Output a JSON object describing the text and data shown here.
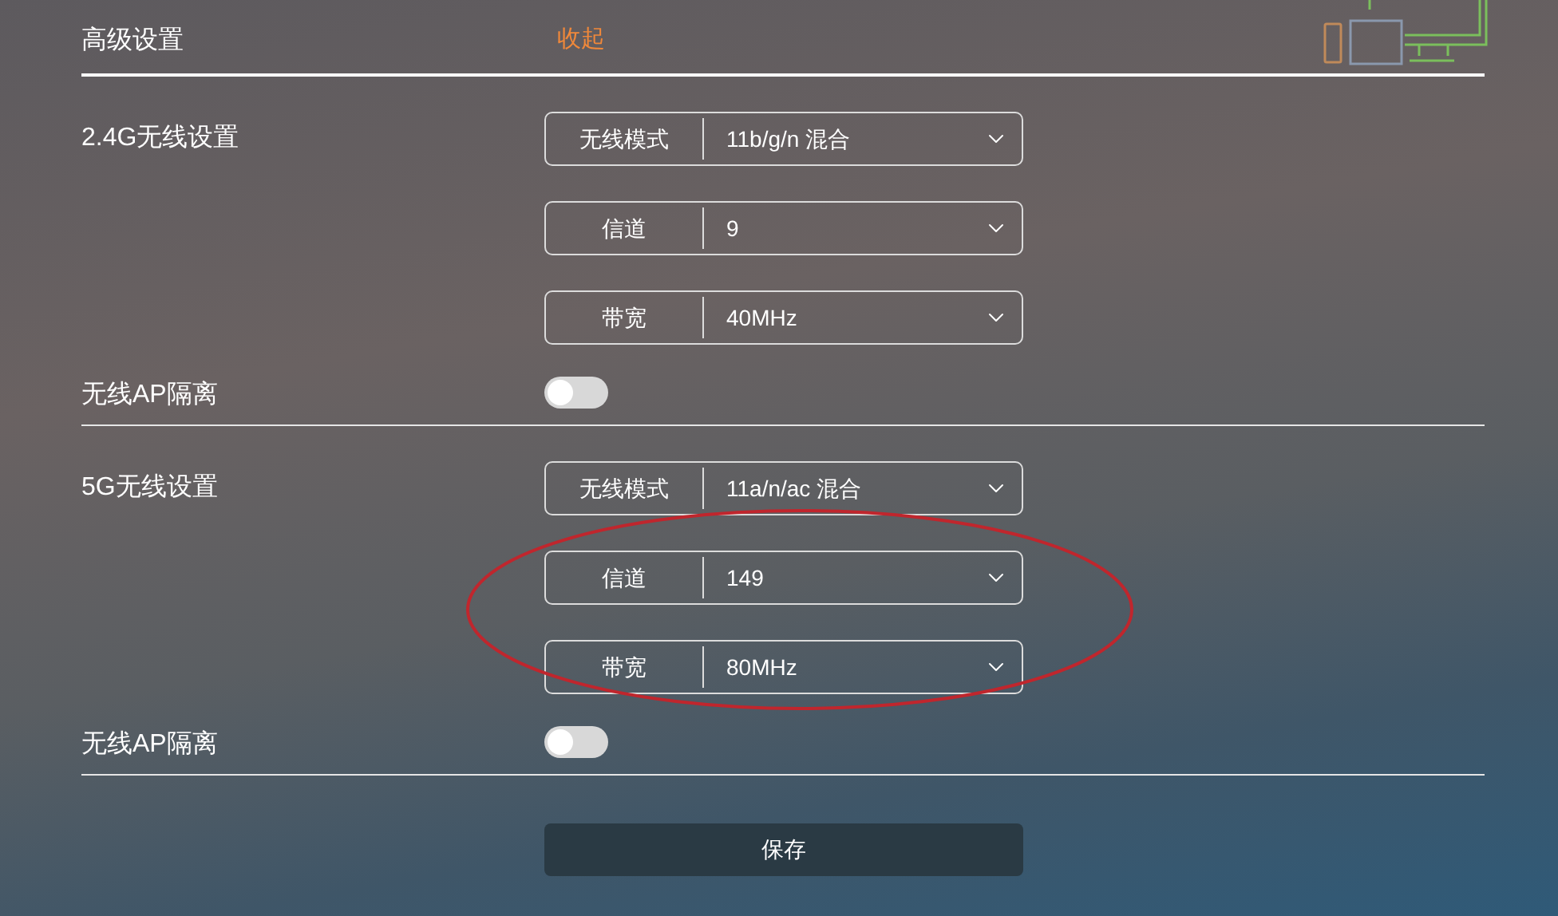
{
  "header": {
    "title": "高级设置",
    "collapse_link": "收起"
  },
  "sections": [
    {
      "title": "2.4G无线设置",
      "fields": [
        {
          "label": "无线模式",
          "value": "11b/g/n 混合"
        },
        {
          "label": "信道",
          "value": "9"
        },
        {
          "label": "带宽",
          "value": "40MHz"
        }
      ],
      "ap_isolation": {
        "label": "无线AP隔离",
        "on": false
      }
    },
    {
      "title": "5G无线设置",
      "fields": [
        {
          "label": "无线模式",
          "value": "11a/n/ac 混合"
        },
        {
          "label": "信道",
          "value": "149"
        },
        {
          "label": "带宽",
          "value": "80MHz"
        }
      ],
      "ap_isolation": {
        "label": "无线AP隔离",
        "on": false
      }
    }
  ],
  "save_button": "保存"
}
